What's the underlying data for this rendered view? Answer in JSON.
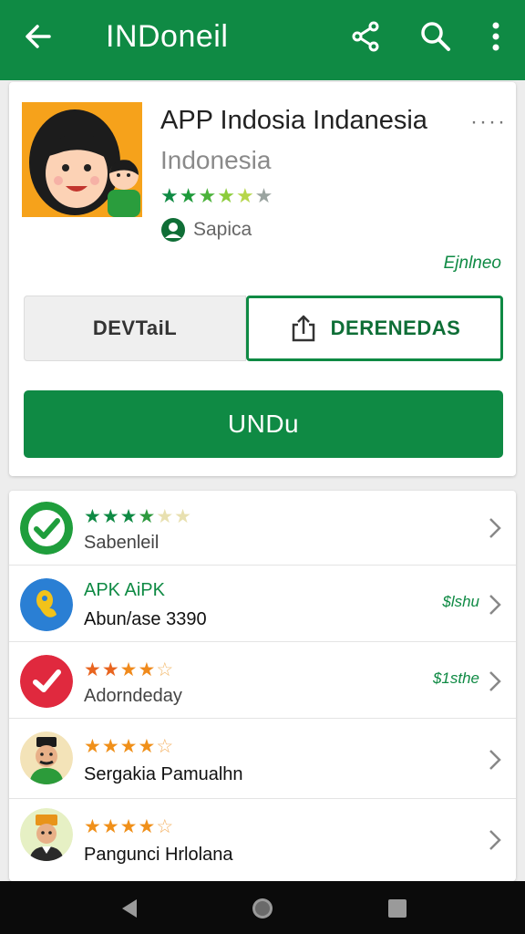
{
  "appbar": {
    "title": "INDoneil",
    "back_icon": "arrow-back-icon",
    "share_icon": "share-icon",
    "search_icon": "search-icon",
    "more_icon": "more-vert-icon",
    "color": "#0f8a44"
  },
  "app": {
    "name": "APP Indosia Indanesia",
    "subtitle": "Indonesia",
    "rating_stars": "★★★★★",
    "developer": "Sapica",
    "overflow": "····",
    "side_link": "Ejnlneo",
    "icon": "cartoon-family-avatar-icon"
  },
  "segment": {
    "left_label": "DEVTaiL",
    "right_label": "DERENEDAS",
    "right_icon": "share-box-icon"
  },
  "primary_button": {
    "label": "UNDu"
  },
  "list": [
    {
      "icon": "green-check-icon",
      "stars": "★★★★★",
      "title": "",
      "subtitle": "Sabenleil",
      "price": ""
    },
    {
      "icon": "blue-app-icon",
      "stars": "",
      "title": "APK AiPK",
      "subtitle": "Abun/ase 3390",
      "price": "$lshu"
    },
    {
      "icon": "red-check-icon",
      "stars": "★★★★☆",
      "title": "",
      "subtitle": "Adorndeday",
      "price": "$1sthe"
    },
    {
      "icon": "man-avatar-icon",
      "stars": "★★★★☆",
      "title": "",
      "subtitle": "Sergakia Pamualhn",
      "price": ""
    },
    {
      "icon": "boy-avatar-icon",
      "stars": "★★★★☆",
      "title": "",
      "subtitle": "Pangunci Hrlolana",
      "price": ""
    }
  ],
  "navbar": {
    "back": "nav-back-icon",
    "home": "nav-home-icon",
    "recents": "nav-recents-icon"
  }
}
